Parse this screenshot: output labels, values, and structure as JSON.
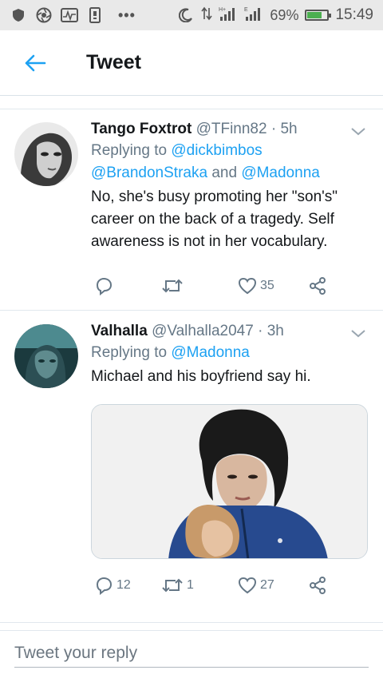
{
  "status_bar": {
    "signal_label": "1l",
    "network_label": "H+",
    "battery_percent": "69%",
    "battery_level": 0.69,
    "time": "15:49",
    "dots": "•••"
  },
  "header": {
    "title": "Tweet",
    "back_icon": "arrow-left-icon"
  },
  "colors": {
    "accent": "#1da1f2",
    "secondary_text": "#657786",
    "primary_text": "#14171a",
    "divider": "#e1e8ed"
  },
  "tweets": [
    {
      "name": "Tango Foxtrot",
      "handle": "@TFinn82",
      "sep": "·",
      "time": "5h",
      "replying_prefix": "Replying to",
      "mention1": "@dickbimbos",
      "mention2": "@BrandonStraka",
      "and_word": "and",
      "mention3": "@Madonna",
      "text": "No, she's busy promoting her \"son's\" career on the back of a tragedy. Self awareness is not in her vocabulary.",
      "reply_count": "",
      "retweet_count": "",
      "like_count": "35"
    },
    {
      "name": "Valhalla",
      "handle": "@Valhalla2047",
      "sep": "·",
      "time": "3h",
      "replying_prefix": "Replying to",
      "mention1": "@Madonna",
      "text": "Michael and his boyfriend say hi.",
      "reply_count": "12",
      "retweet_count": "1",
      "like_count": "27"
    }
  ],
  "reply_bar": {
    "placeholder": "Tweet your reply"
  }
}
